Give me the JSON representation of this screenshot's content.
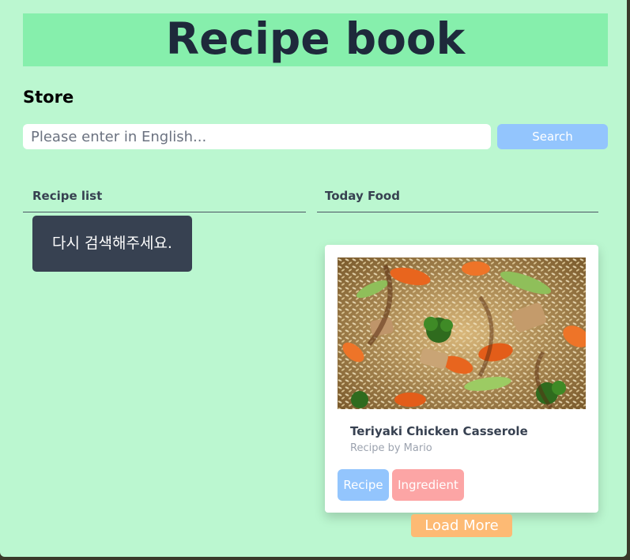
{
  "header": {
    "title": "Recipe book"
  },
  "store": {
    "title": "Store",
    "search_placeholder": "Please enter in English...",
    "search_label": "Search"
  },
  "recipe_list": {
    "heading": "Recipe list",
    "message": "다시 검색해주세요."
  },
  "today_food": {
    "heading": "Today Food",
    "card": {
      "title": "Teriyaki Chicken Casserole",
      "author": "Recipe by Mario",
      "recipe_label": "Recipe",
      "ingredient_label": "Ingredient"
    },
    "load_more_label": "Load More"
  },
  "colors": {
    "page_background": "#bbf7d0",
    "header_background": "#86efac",
    "search_button": "#93c5fd",
    "ingredient_button": "#fca5a5",
    "load_more_button": "#fdba74",
    "message_box": "#374151"
  }
}
